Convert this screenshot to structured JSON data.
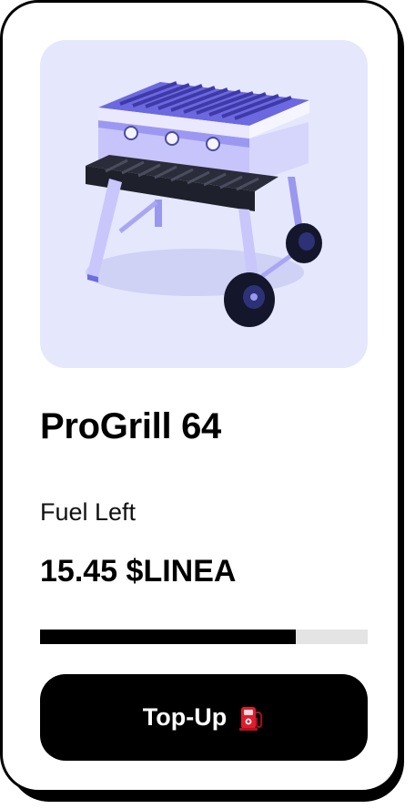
{
  "product": {
    "image_alt": "grill-illustration",
    "name": "ProGrill 64"
  },
  "fuel": {
    "label": "Fuel Left",
    "value": "15.45 $LINEA",
    "progress_fraction": 0.78
  },
  "actions": {
    "topup_label": "Top-Up",
    "topup_icon": "fuel-pump-icon"
  },
  "colors": {
    "image_bg": "#e5e7fd",
    "grill_primary": "#8b87f0",
    "progress_fill": "#000000",
    "progress_track": "#e4e4e4",
    "button_bg": "#000000",
    "button_text": "#ffffff",
    "pump_icon": "#e21b2d"
  }
}
